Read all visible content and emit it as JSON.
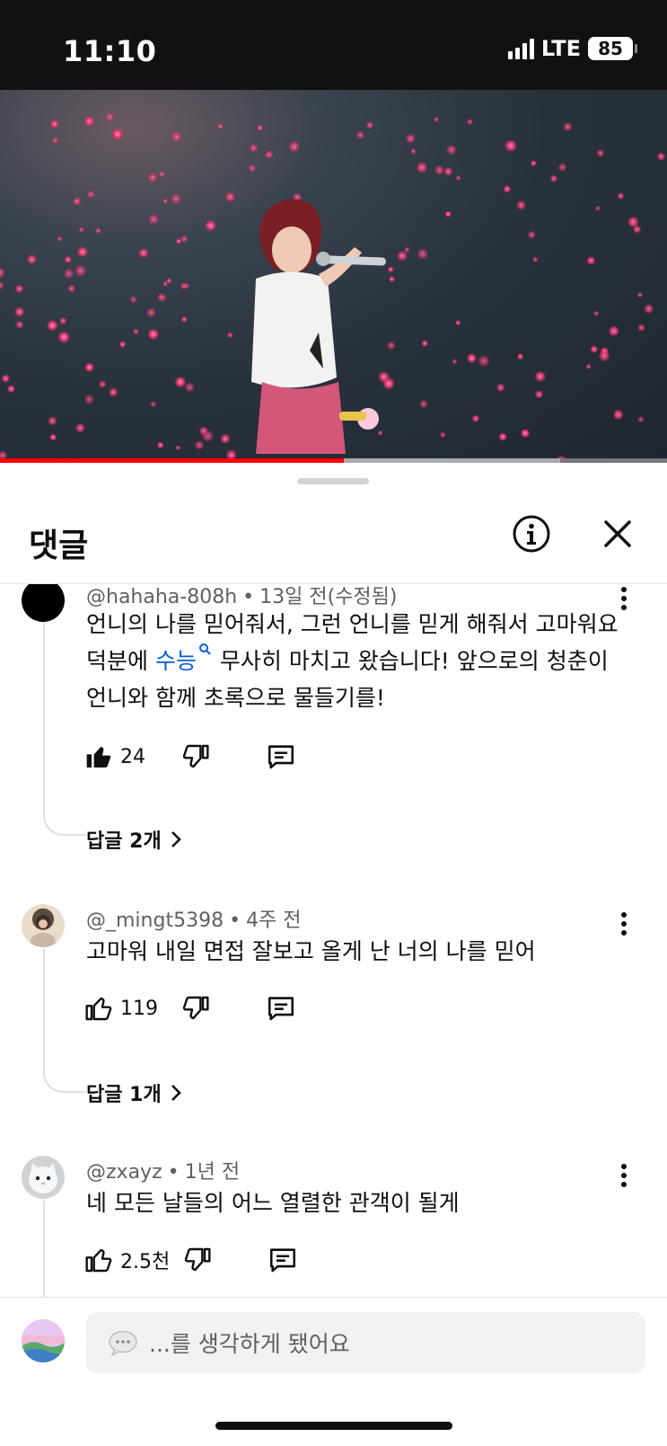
{
  "status_bar": {
    "time": "11:10",
    "network": "LTE",
    "battery": "85"
  },
  "video": {
    "progress": 0.515,
    "buffered": 0.84
  },
  "sheet": {
    "title": "댓글"
  },
  "comments": [
    {
      "author": "@hahaha-808h",
      "time": "13일 전(수정됨)",
      "text_before": "언니의 나를 믿어줘서, 그런 언니를 믿게 해줘서 고마워요 덕분에 ",
      "link": "수능",
      "text_after": " 무사히 마치고 왔습니다! 앞으로의 청춘이 언니와 함께 초록으로 물들기를!",
      "likes": "24",
      "liked": true,
      "replies": "답글 2개"
    },
    {
      "author": "@_mingt5398",
      "time": "4주 전",
      "text": "고마워 내일 면접 잘보고 올게 난 너의 나를 믿어",
      "likes": "119",
      "liked": false,
      "replies": "답글 1개"
    },
    {
      "author": "@zxayz",
      "time": "1년 전",
      "text": "네 모든 날들의 어느 열렬한 관객이 될게",
      "likes": "2.5천",
      "liked": false
    }
  ],
  "composer": {
    "placeholder": "...를 생각하게 됐어요"
  },
  "icons": [
    "signal-icon",
    "battery-icon",
    "info-icon",
    "close-icon",
    "more-vert-icon",
    "thumb-up-icon",
    "thumb-down-icon",
    "reply-icon",
    "chevron-right-icon",
    "search-icon",
    "comment-bubble-icon"
  ],
  "colors": {
    "accent_red": "#ff0000",
    "link_blue": "#065fd4"
  }
}
